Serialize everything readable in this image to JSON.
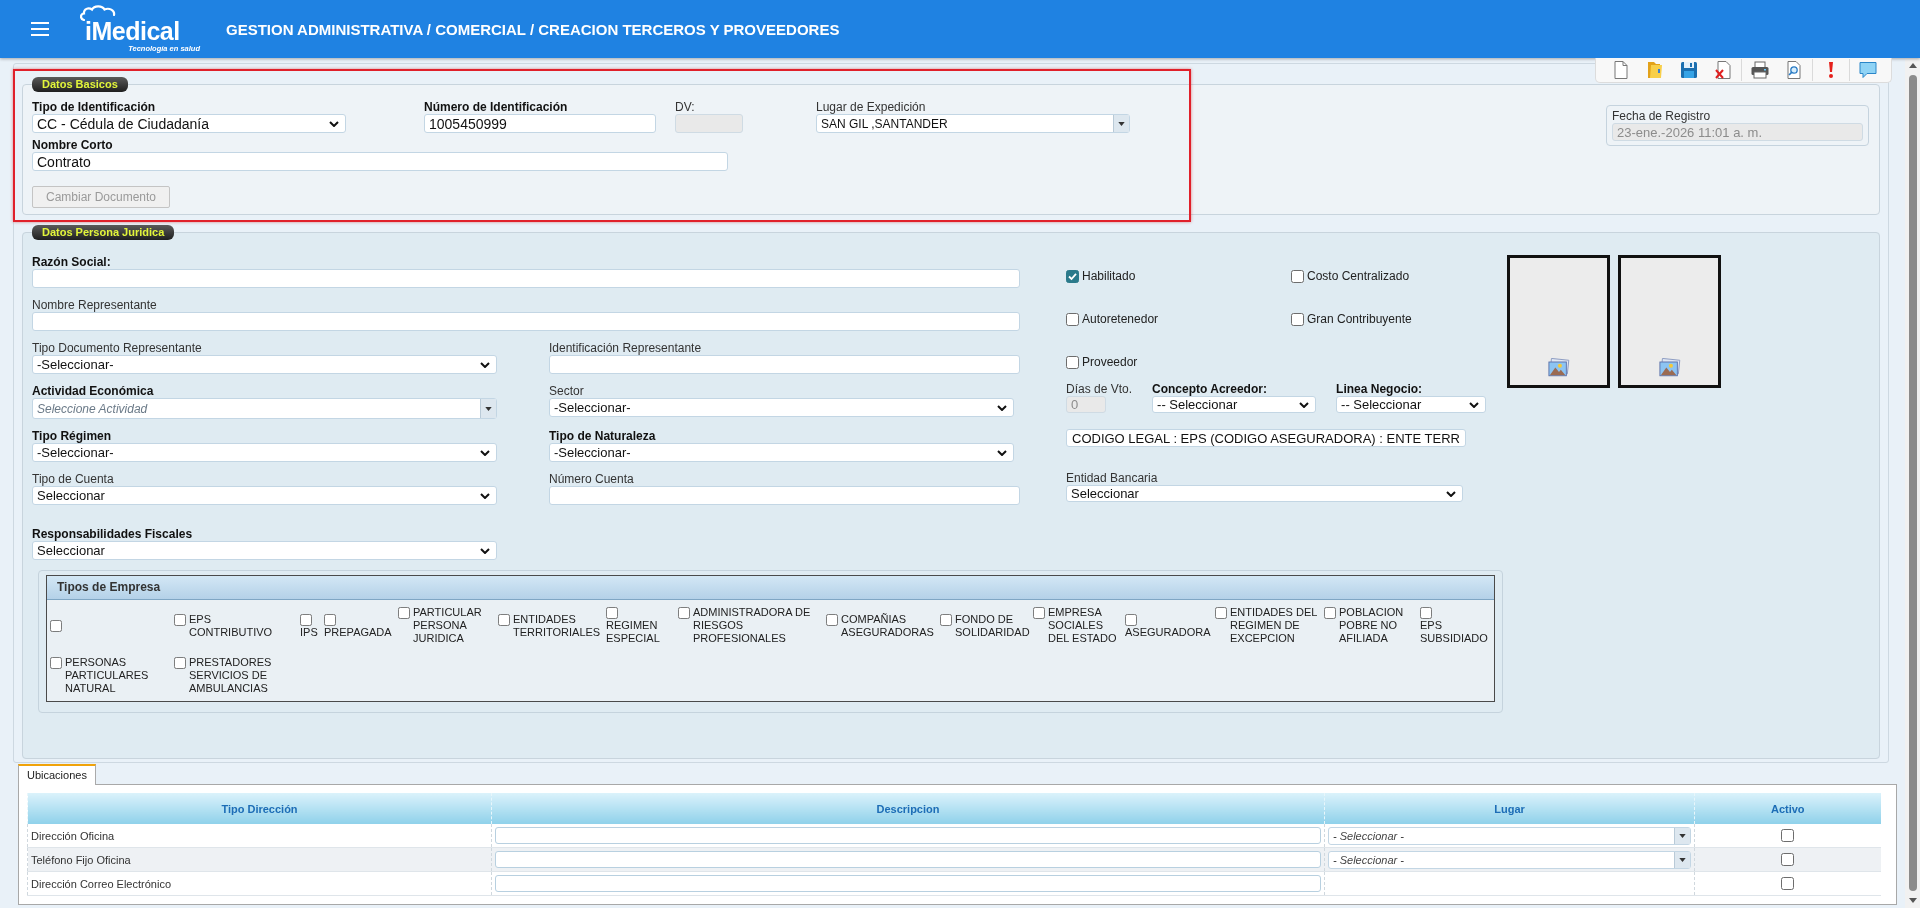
{
  "header": {
    "logo": "iMedical",
    "tagline": "Tecnología en salud",
    "title": "GESTION ADMINISTRATIVA / COMERCIAL / CREACION TERCEROS Y PROVEEDORES"
  },
  "datos_basicos": {
    "legend": "Datos Basicos",
    "tipo_identificacion": {
      "label": "Tipo de Identificación",
      "required": true,
      "value": "CC - Cédula de Ciudadanía"
    },
    "numero_identificacion": {
      "label": "Número de Identificación",
      "required": true,
      "value": "1005450999"
    },
    "dv": {
      "label": "DV:",
      "required": false,
      "disabled": true
    },
    "lugar_expedicion": {
      "label": "Lugar de Expedición",
      "required": false,
      "value": "SAN GIL ,SANTANDER"
    },
    "nombre_corto": {
      "label": "Nombre Corto",
      "required": true,
      "value": "Contrato"
    },
    "cambiar_documento": {
      "label": "Cambiar Documento",
      "disabled": true
    }
  },
  "fecha_registro": {
    "label": "Fecha de Registro",
    "value": "23-ene.-2026 11:01 a. m.",
    "disabled": true
  },
  "persona_juridica": {
    "legend": "Datos Persona Juridica",
    "razon_social": {
      "label": "Razón Social:",
      "required": true
    },
    "nombre_representante": {
      "label": "Nombre Representante",
      "required": false
    },
    "tipo_documento_representante": {
      "label": "Tipo Documento Representante",
      "required": false,
      "value": "-Seleccionar-"
    },
    "identificacion_representante": {
      "label": "Identificación Representante",
      "required": false
    },
    "actividad_economica": {
      "label": "Actividad Económica",
      "required": true,
      "placeholder": "Seleccione Actividad"
    },
    "sector": {
      "label": "Sector",
      "required": false,
      "value": "-Seleccionar-"
    },
    "tipo_regimen": {
      "label": "Tipo Régimen",
      "required": true,
      "value": "-Seleccionar-"
    },
    "tipo_naturaleza": {
      "label": "Tipo de Naturaleza",
      "required": true,
      "value": "-Seleccionar-"
    },
    "tipo_cuenta": {
      "label": "Tipo de Cuenta",
      "required": false,
      "value": "Seleccionar"
    },
    "numero_cuenta": {
      "label": "Número Cuenta",
      "required": false
    },
    "responsabilidades_fiscales": {
      "label": "Responsabilidades Fiscales",
      "required": true,
      "value": "Seleccionar"
    },
    "checks": [
      {
        "label": "Habilitado",
        "checked": true
      },
      {
        "label": "Costo Centralizado",
        "checked": false
      },
      {
        "label": "Autoretenedor",
        "checked": false
      },
      {
        "label": "Gran Contribuyente",
        "checked": false
      },
      {
        "label": "Proveedor",
        "checked": false
      }
    ],
    "dias_vto": {
      "label": "Días de Vto.",
      "required": false,
      "value": "0",
      "disabled": true
    },
    "concepto_acreedor": {
      "label": "Concepto Acreedor:",
      "required": true,
      "value": "-- Seleccionar"
    },
    "linea_negocio": {
      "label": "Linea Negocio:",
      "required": true,
      "value": "-- Seleccionar"
    },
    "codigo_legal": {
      "value": "CODIGO LEGAL : EPS (CODIGO ASEGURADORA) : ENTE TERR"
    },
    "entidad_bancaria": {
      "label": "Entidad Bancaria",
      "required": false,
      "value": "Seleccionar"
    },
    "tipos_empresa": {
      "title": "Tipos de Empresa",
      "items": [
        {
          "checked": false
        },
        {
          "label": "EPS CONTRIBUTIVO",
          "checked": false
        },
        {
          "label": "IPS",
          "checked": false
        },
        {
          "label": "PREPAGADA",
          "checked": false
        },
        {
          "label": "PARTICULAR PERSONA JURIDICA",
          "checked": false
        },
        {
          "label": "ENTIDADES TERRITORIALES",
          "checked": false
        },
        {
          "label": "REGIMEN ESPECIAL",
          "checked": false
        },
        {
          "label": "ADMINISTRADORA DE RIESGOS PROFESIONALES",
          "checked": false
        },
        {
          "label": "COMPAÑIAS ASEGURADORAS",
          "checked": false
        },
        {
          "label": "FONDO DE SOLIDARIDAD",
          "checked": false
        },
        {
          "label": "EMPRESA SOCIALES DEL ESTADO",
          "checked": false
        },
        {
          "label": "ASEGURADORA",
          "checked": false
        },
        {
          "label": "ENTIDADES DEL REGIMEN DE EXCEPCION",
          "checked": false
        },
        {
          "label": "POBLACION POBRE NO AFILIADA",
          "checked": false
        },
        {
          "label": "EPS SUBSIDIADO",
          "checked": false
        },
        {
          "label": "PERSONAS PARTICULARES NATURAL",
          "checked": false
        },
        {
          "label": "PRESTADORES SERVICIOS DE AMBULANCIAS",
          "checked": false
        }
      ]
    }
  },
  "ubicaciones": {
    "tab": {
      "label": "Ubicaciones",
      "selected": true
    },
    "columns": [
      "Tipo Dirección",
      "Descripcion",
      "Lugar",
      "Activo"
    ],
    "rows": [
      {
        "tipo": "Dirección Oficina",
        "lugar": {
          "placeholder": "- Seleccionar -"
        },
        "activo": false
      },
      {
        "tipo": "Teléfono Fijo Oficina",
        "lugar": {
          "placeholder": "- Seleccionar -"
        },
        "activo": false
      },
      {
        "tipo": "Dirección Correo Electrónico",
        "activo": false
      }
    ]
  }
}
